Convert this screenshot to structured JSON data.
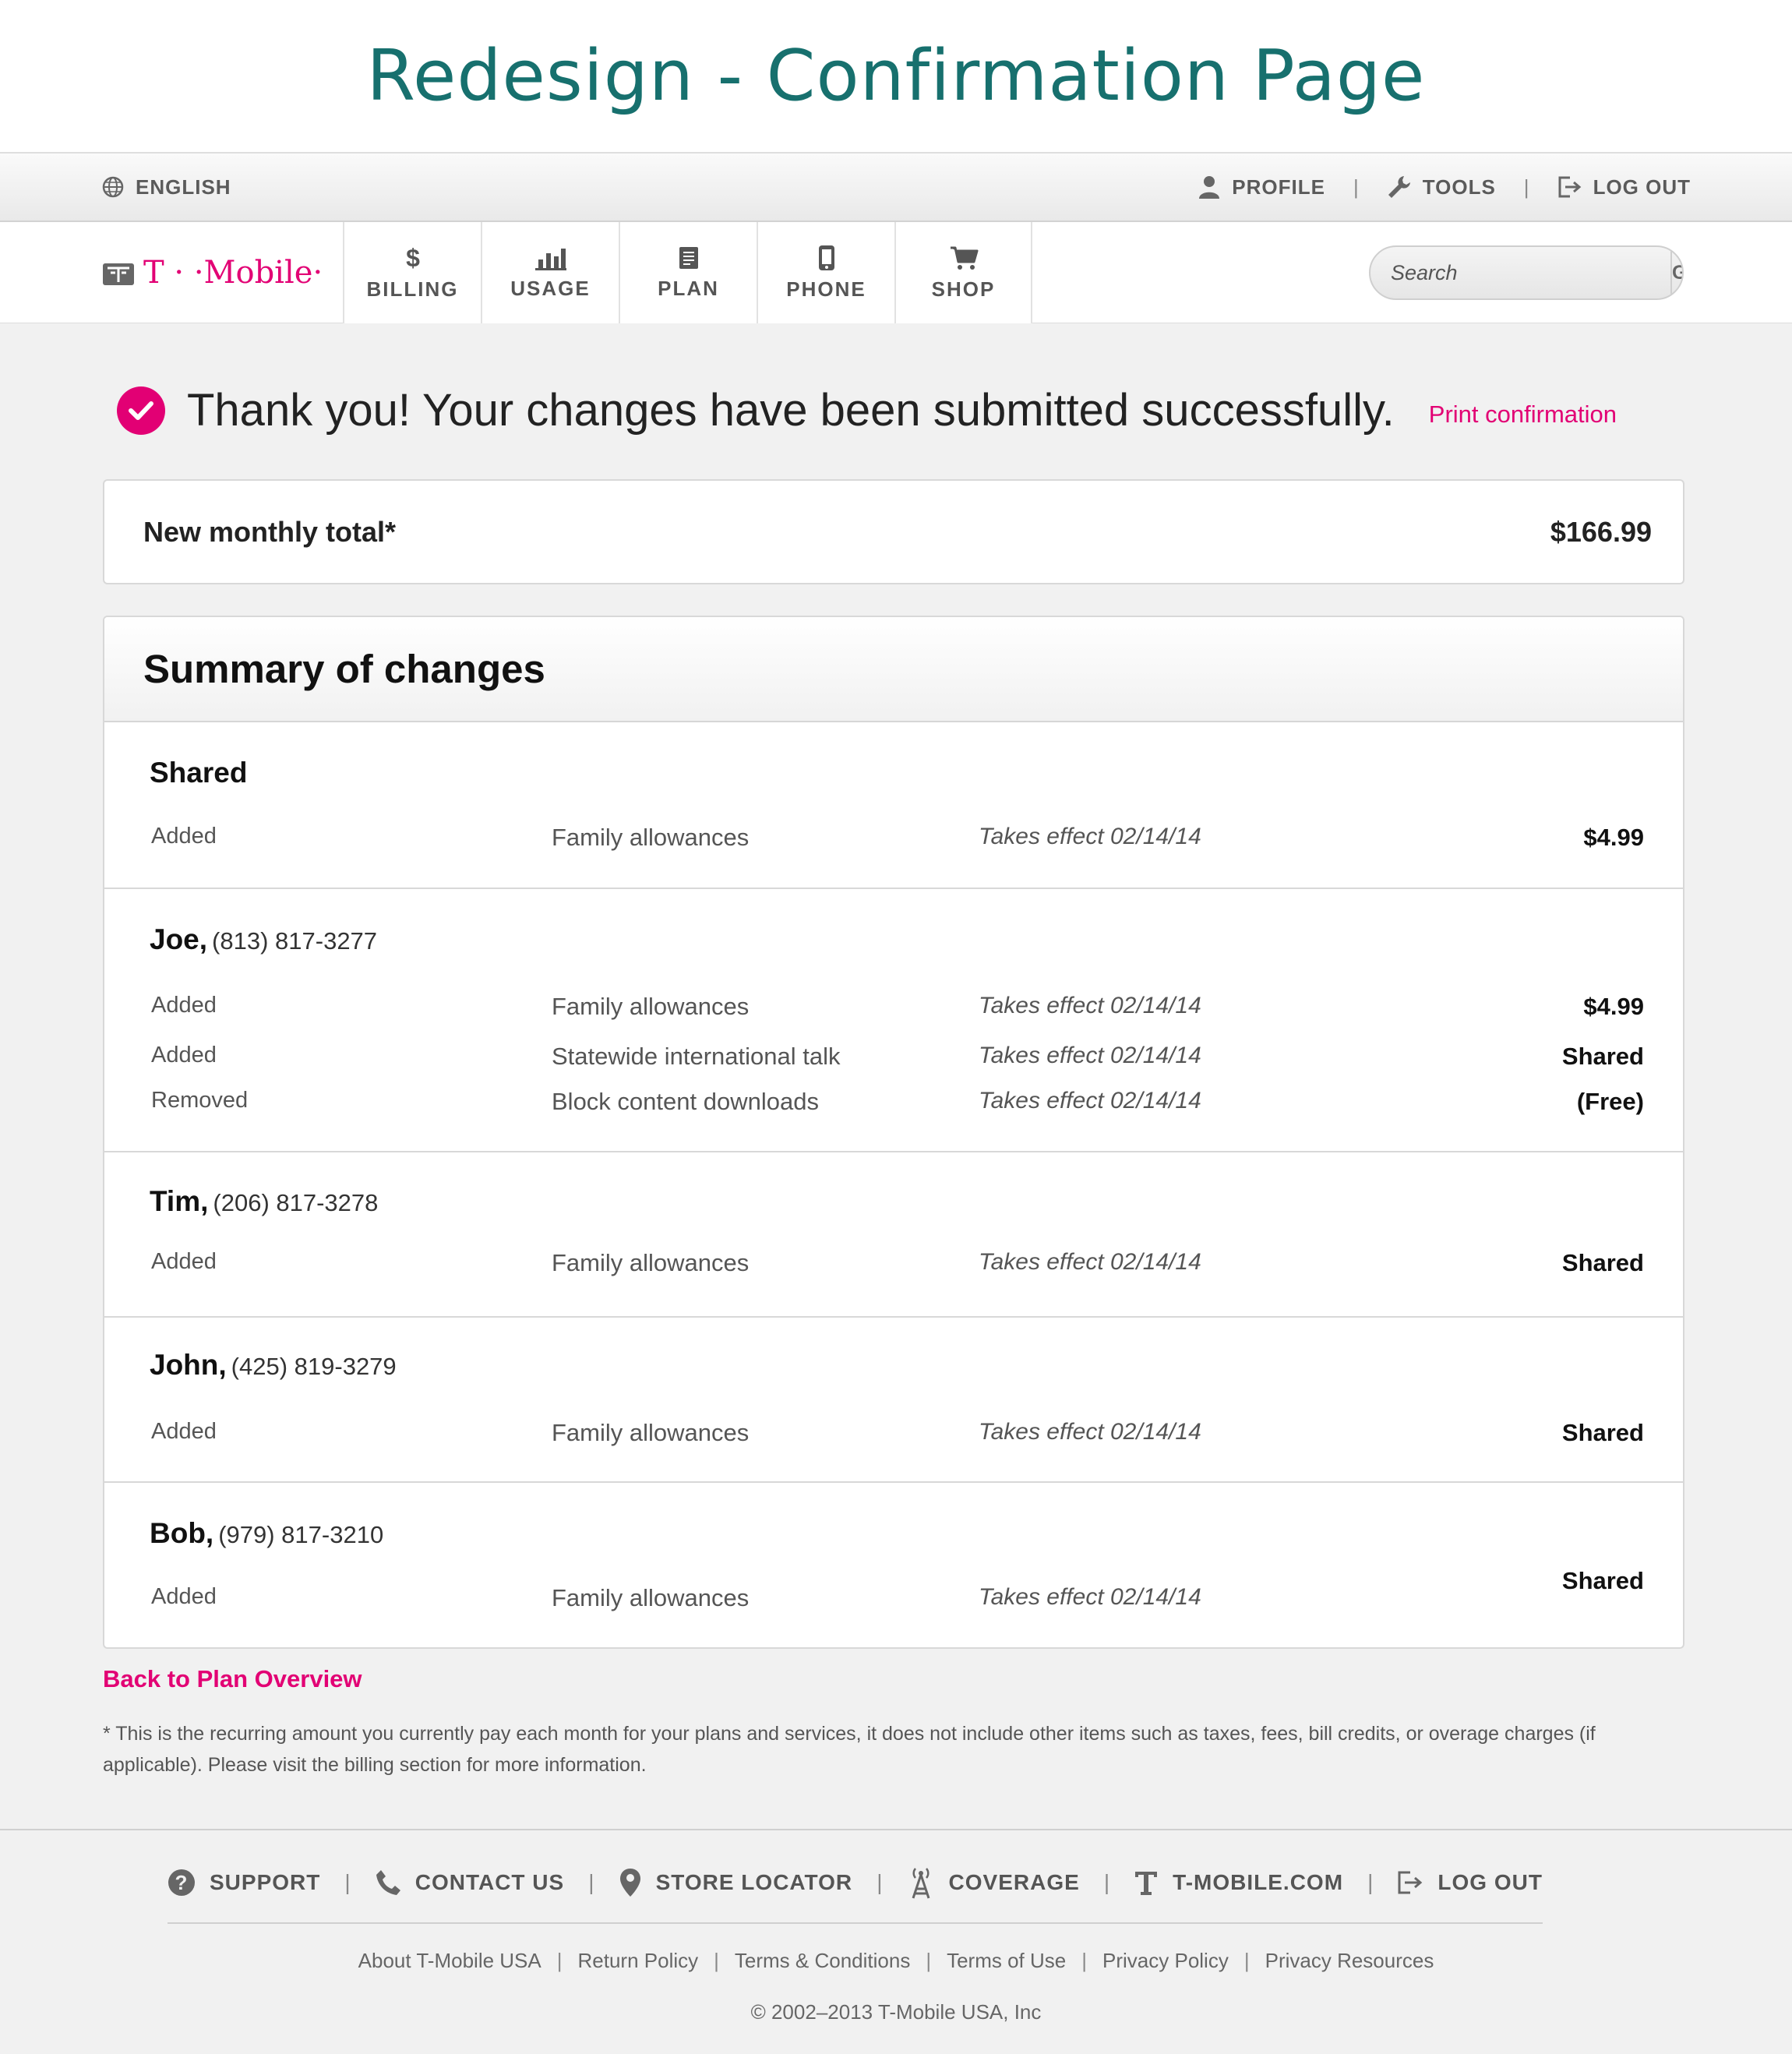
{
  "page_title": "Redesign - Confirmation Page",
  "colors": {
    "brand_magenta": "#e20074",
    "title_teal": "#17706e",
    "page_bg": "#f1f1f1"
  },
  "utility": {
    "language": "ENGLISH",
    "profile": "PROFILE",
    "tools": "TOOLS",
    "logout": "LOG OUT",
    "separator": "|"
  },
  "nav": {
    "logo_text": "T · ·Mobile·",
    "tabs": [
      {
        "label": "BILLING",
        "icon": "dollar-icon"
      },
      {
        "label": "USAGE",
        "icon": "bar-chart-icon"
      },
      {
        "label": "PLAN",
        "icon": "document-icon"
      },
      {
        "label": "PHONE",
        "icon": "phone-icon"
      },
      {
        "label": "SHOP",
        "icon": "cart-icon"
      }
    ],
    "search_placeholder": "Search",
    "search_button": "GO"
  },
  "confirmation": {
    "message": "Thank you! Your changes have been submitted successfully.",
    "print_link": "Print confirmation"
  },
  "total": {
    "label": "New monthly total*",
    "value": "$166.99"
  },
  "summary": {
    "heading": "Summary of changes",
    "groups": [
      {
        "name": "Shared",
        "phone": "",
        "rows": [
          {
            "action": "Added",
            "item": "Family allowances",
            "effective": "Takes effect 02/14/14",
            "price": "$4.99"
          }
        ]
      },
      {
        "name": "Joe,",
        "phone": "(813) 817-3277",
        "rows": [
          {
            "action": "Added",
            "item": "Family allowances",
            "effective": "Takes effect 02/14/14",
            "price": "$4.99"
          },
          {
            "action": "Added",
            "item": "Statewide international talk",
            "effective": "Takes effect 02/14/14",
            "price": "Shared"
          },
          {
            "action": "Removed",
            "item": "Block content downloads",
            "effective": "Takes effect 02/14/14",
            "price": "(Free)"
          }
        ]
      },
      {
        "name": "Tim,",
        "phone": "(206) 817-3278",
        "rows": [
          {
            "action": "Added",
            "item": "Family allowances",
            "effective": "Takes effect 02/14/14",
            "price": "Shared"
          }
        ]
      },
      {
        "name": "John,",
        "phone": "(425) 819-3279",
        "rows": [
          {
            "action": "Added",
            "item": "Family allowances",
            "effective": "Takes effect 02/14/14",
            "price": "Shared"
          }
        ]
      },
      {
        "name": "Bob,",
        "phone": "(979) 817-3210",
        "rows": [
          {
            "action": "Added",
            "item": "Family allowances",
            "effective": "Takes effect 02/14/14",
            "price": "Shared"
          }
        ]
      }
    ]
  },
  "back_link": "Back to Plan Overview",
  "footnote": "* This is the recurring amount you currently pay each month for your plans and services, it does not include other items such as taxes, fees, bill credits, or overage charges (if applicable). Please visit the billing section for more information.",
  "footer": {
    "links": [
      "SUPPORT",
      "CONTACT US",
      "STORE LOCATOR",
      "COVERAGE",
      "T-MOBILE.COM",
      "LOG OUT"
    ],
    "legal": [
      "About T-Mobile USA",
      "Return Policy",
      "Terms & Conditions",
      "Terms of Use",
      "Privacy Policy",
      "Privacy Resources"
    ],
    "copyright": "© 2002–2013 T-Mobile USA, Inc"
  }
}
